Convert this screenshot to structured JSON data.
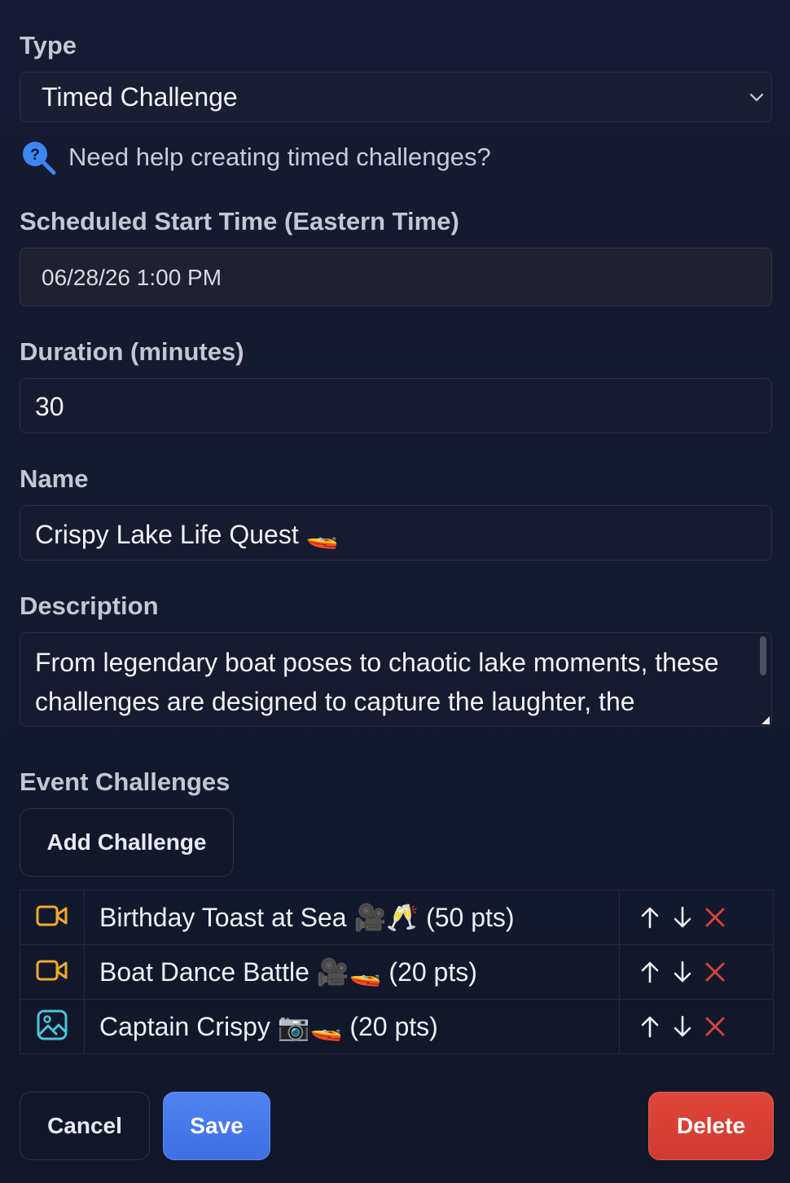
{
  "type": {
    "label": "Type",
    "selected": "Timed Challenge",
    "help_text": "Need help creating timed challenges?"
  },
  "schedule": {
    "label": "Scheduled Start Time (Eastern Time)",
    "value": "06/28/26 1:00 PM"
  },
  "duration": {
    "label": "Duration (minutes)",
    "value": "30"
  },
  "name": {
    "label": "Name",
    "value": "Crispy Lake Life Quest 🚤"
  },
  "description": {
    "label": "Description",
    "value": "From legendary boat poses to chaotic lake moments, these challenges are designed to capture the laughter, the"
  },
  "challenges": {
    "label": "Event Challenges",
    "add_button": "Add Challenge",
    "items": [
      {
        "icon": "video-icon",
        "name": "Birthday Toast at Sea 🎥🥂 (50 pts)"
      },
      {
        "icon": "video-icon",
        "name": "Boat Dance Battle 🎥🚤 (20 pts)"
      },
      {
        "icon": "image-icon",
        "name": "Captain Crispy 📷🚤 (20 pts)"
      }
    ]
  },
  "footer": {
    "cancel": "Cancel",
    "save": "Save",
    "delete": "Delete"
  },
  "colors": {
    "accent_blue": "#4a7ef0",
    "danger_red": "#d9443a",
    "video_icon": "#f0a92a",
    "image_icon": "#4cc3d9"
  }
}
